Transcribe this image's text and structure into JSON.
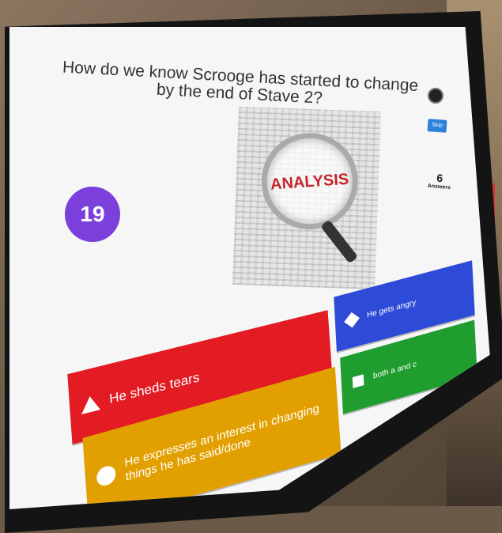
{
  "question": "How do we know Scrooge has started to change by the end of Stave 2?",
  "skip_label": "Skip",
  "timer": "19",
  "answers_count": {
    "number": "6",
    "label": "Answers"
  },
  "image_caption": "ANALYSIS",
  "answers": [
    {
      "shape": "triangle-icon",
      "text": "He sheds tears",
      "color": "#e31b23"
    },
    {
      "shape": "diamond-icon",
      "text": "He gets angry",
      "color": "#2e4bd8"
    },
    {
      "shape": "circle-icon",
      "text": "He expresses an interest in changing things he has said/done",
      "color": "#e2a000"
    },
    {
      "shape": "square-icon",
      "text": "both a and c",
      "color": "#1f9d2e"
    }
  ],
  "colors": {
    "timer": "#7b3fdc",
    "skip": "#2b82d9"
  }
}
